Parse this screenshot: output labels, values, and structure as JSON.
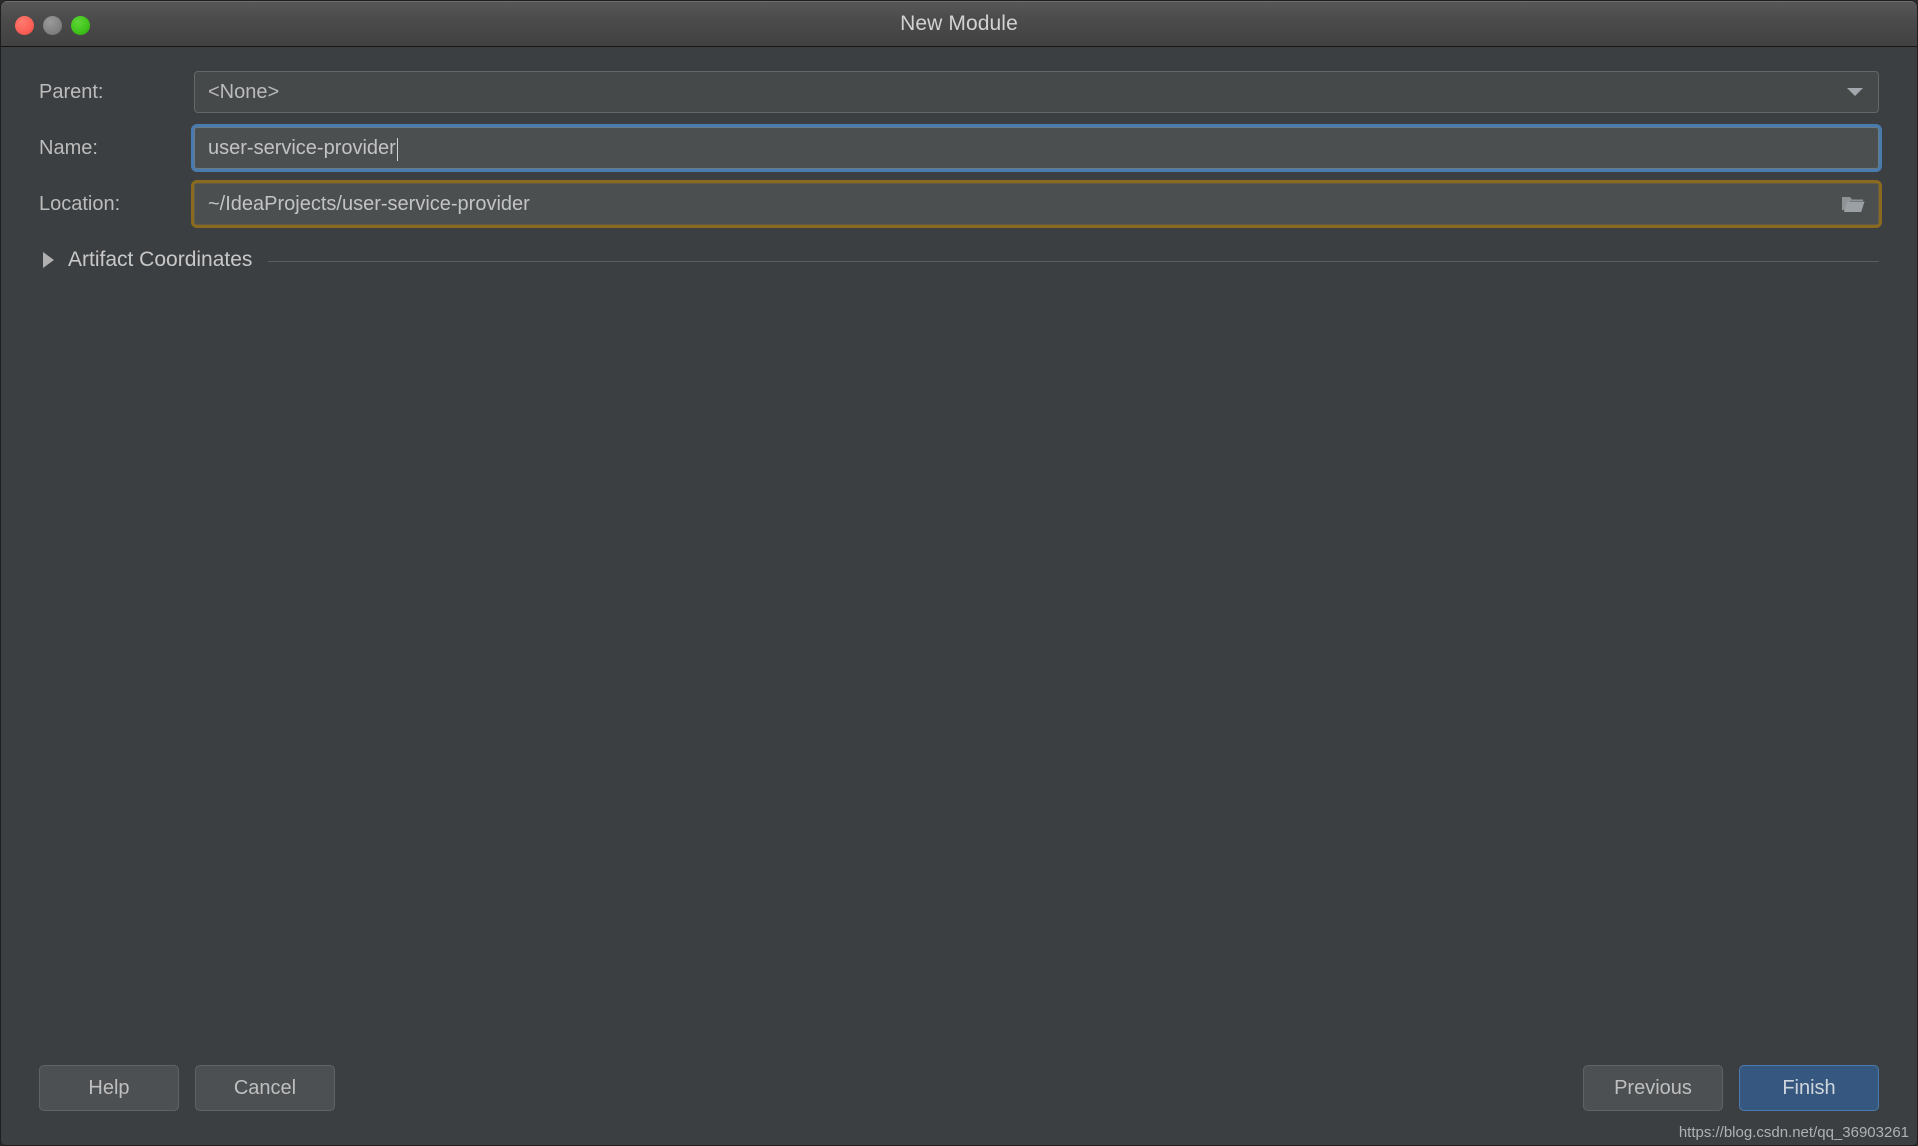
{
  "window": {
    "title": "New Module",
    "traffic_lights": [
      "close",
      "minimize",
      "maximize"
    ]
  },
  "form": {
    "parent": {
      "label": "Parent:",
      "value": "<None>",
      "options": [
        "<None>"
      ]
    },
    "name": {
      "label": "Name:",
      "value": "user-service-provider",
      "placeholder": ""
    },
    "location": {
      "label": "Location:",
      "value": "~/IdeaProjects/user-service-provider",
      "placeholder": "",
      "browse_icon": "folder-icon"
    }
  },
  "sections": {
    "artifact_coordinates": {
      "label": "Artifact Coordinates",
      "expanded": false,
      "toggle_icon": "triangle-right-icon"
    }
  },
  "buttons": {
    "help": "Help",
    "cancel": "Cancel",
    "previous": "Previous",
    "finish": "Finish"
  },
  "watermark": "https://blog.csdn.net/qq_36903261",
  "colors": {
    "background": "#3c3f41",
    "field_background": "#4b4f50",
    "focus_border": "#4a7bae",
    "warning_border": "#8a6a1e",
    "default_button": "#365880",
    "text": "#bcbcbc",
    "traffic_close": "#fc5f55",
    "traffic_min": "#828282",
    "traffic_max": "#3ec219"
  }
}
